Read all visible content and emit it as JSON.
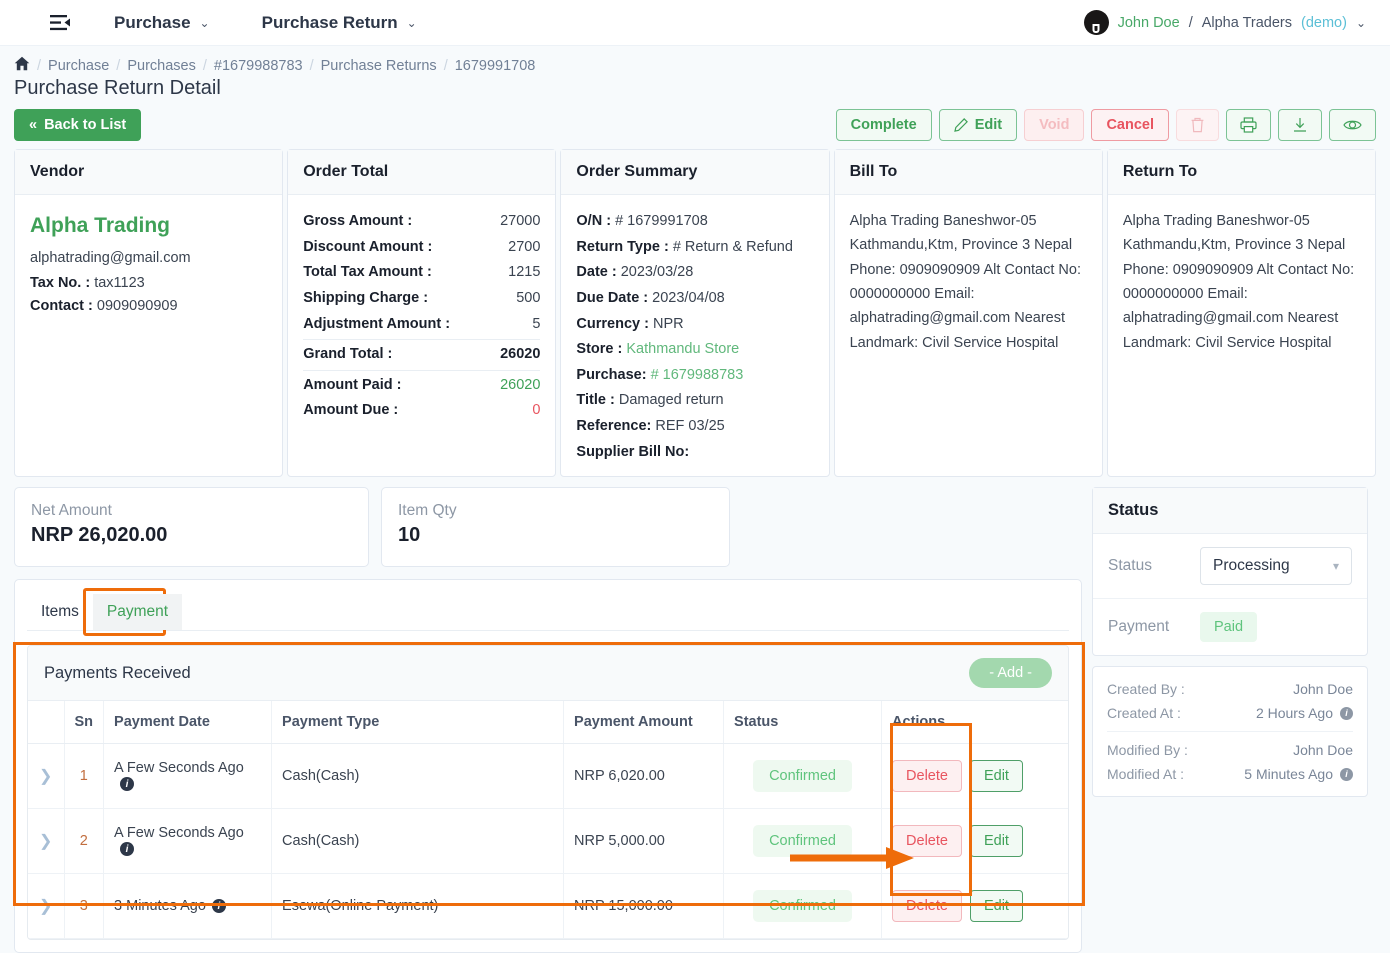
{
  "topnav": {
    "menu_icon": "menu-collapse-icon",
    "items": [
      {
        "label": "Purchase",
        "caret": "⌄"
      },
      {
        "label": "Purchase Return",
        "caret": "⌄"
      }
    ],
    "user": {
      "name": "John Doe",
      "separator": "/",
      "org": "Alpha Traders",
      "demo": "(demo)",
      "caret": "⌄"
    }
  },
  "breadcrumb": {
    "home_icon": "⌂",
    "items": [
      "Purchase",
      "Purchases",
      "#1679988783",
      "Purchase Returns",
      "1679991708"
    ],
    "separator": "/"
  },
  "page": {
    "title": "Purchase Return Detail"
  },
  "actions": {
    "back": "Back to List",
    "back_icon": "«",
    "complete": "Complete",
    "edit": "Edit",
    "edit_icon": "✎",
    "void": "Void",
    "cancel": "Cancel",
    "delete_icon": "Ὕ1",
    "print_icon": "print-icon",
    "download_icon": "download-icon",
    "view_icon": "eye-icon"
  },
  "vendor": {
    "heading": "Vendor",
    "name": "Alpha Trading",
    "email": "alphatrading@gmail.com",
    "tax_label": "Tax No. :",
    "tax_value": "tax1123",
    "contact_label": "Contact :",
    "contact_value": "0909090909"
  },
  "order_total": {
    "heading": "Order Total",
    "rows": [
      {
        "label": "Gross Amount :",
        "value": "27000",
        "style": ""
      },
      {
        "label": "Discount Amount :",
        "value": "2700",
        "style": ""
      },
      {
        "label": "Total Tax Amount :",
        "value": "1215",
        "style": ""
      },
      {
        "label": "Shipping Charge :",
        "value": "500",
        "style": ""
      },
      {
        "label": "Adjustment Amount :",
        "value": "5",
        "style": ""
      },
      {
        "label": "Grand Total :",
        "value": "26020",
        "style": "grand"
      },
      {
        "label": "Amount Paid :",
        "value": "26020",
        "style": "green"
      },
      {
        "label": "Amount Due :",
        "value": "0",
        "style": "red"
      }
    ]
  },
  "order_summary": {
    "heading": "Order Summary",
    "rows": [
      {
        "label": "O/N :",
        "value": "# 1679991708",
        "link": false
      },
      {
        "label": "Return Type :",
        "value": "# Return & Refund",
        "link": false
      },
      {
        "label": "Date :",
        "value": "2023/03/28",
        "link": false
      },
      {
        "label": "Due Date :",
        "value": "2023/04/08",
        "link": false
      },
      {
        "label": "Currency :",
        "value": "NPR",
        "link": false
      },
      {
        "label": "Store :",
        "value": "Kathmandu Store",
        "link": true
      },
      {
        "label": "Purchase:",
        "value": "# 1679988783",
        "link": true
      },
      {
        "label": "Title :",
        "value": "Damaged return",
        "link": false
      },
      {
        "label": "Reference:",
        "value": "REF 03/25",
        "link": false
      },
      {
        "label": "Supplier Bill No:",
        "value": "",
        "link": false
      }
    ]
  },
  "bill_to": {
    "heading": "Bill To",
    "address": "Alpha Trading Baneshwor-05 Kathmandu,Ktm, Province 3 Nepal Phone: 0909090909 Alt Contact No: 0000000000 Email: alphatrading@gmail.com Nearest Landmark: Civil Service Hospital"
  },
  "return_to": {
    "heading": "Return To",
    "address": "Alpha Trading Baneshwor-05 Kathmandu,Ktm, Province 3 Nepal Phone: 0909090909 Alt Contact No: 0000000000 Email: alphatrading@gmail.com Nearest Landmark: Civil Service Hospital"
  },
  "stats": [
    {
      "label": "Net Amount",
      "value": "NRP 26,020.00"
    },
    {
      "label": "Item Qty",
      "value": "10"
    }
  ],
  "tabs": [
    {
      "label": "Items",
      "active": false
    },
    {
      "label": "Payment",
      "active": true
    }
  ],
  "payments": {
    "title": "Payments Received",
    "add_label": "- Add -",
    "columns": [
      "",
      "Sn",
      "Payment Date",
      "Payment Type",
      "Payment Amount",
      "Status",
      "Actions"
    ],
    "rows": [
      {
        "sn": "1",
        "date": "A Few Seconds Ago",
        "type": "Cash(Cash)",
        "amount": "NRP 6,020.00",
        "status": "Confirmed",
        "delete": "Delete",
        "edit": "Edit"
      },
      {
        "sn": "2",
        "date": "A Few Seconds Ago",
        "type": "Cash(Cash)",
        "amount": "NRP 5,000.00",
        "status": "Confirmed",
        "delete": "Delete",
        "edit": "Edit"
      },
      {
        "sn": "3",
        "date": "3 Minutes Ago",
        "type": "Esewa(Online Payment)",
        "amount": "NRP 15,000.00",
        "status": "Confirmed",
        "delete": "Delete",
        "edit": "Edit"
      }
    ]
  },
  "status_panel": {
    "heading": "Status",
    "status_label": "Status",
    "status_value": "Processing",
    "payment_label": "Payment",
    "payment_value": "Paid"
  },
  "meta": [
    {
      "key": "Created By :",
      "value": "John Doe",
      "info": false
    },
    {
      "key": "Created At :",
      "value": "2 Hours Ago",
      "info": true
    },
    {
      "key": "Modified By :",
      "value": "John Doe",
      "info": false
    },
    {
      "key": "Modified At :",
      "value": "5 Minutes Ago",
      "info": true
    }
  ],
  "colors": {
    "primary_green": "#3fa158",
    "danger_red": "#e8545f",
    "annotation_orange": "#ee6c0a",
    "link_green": "#61b87c"
  }
}
